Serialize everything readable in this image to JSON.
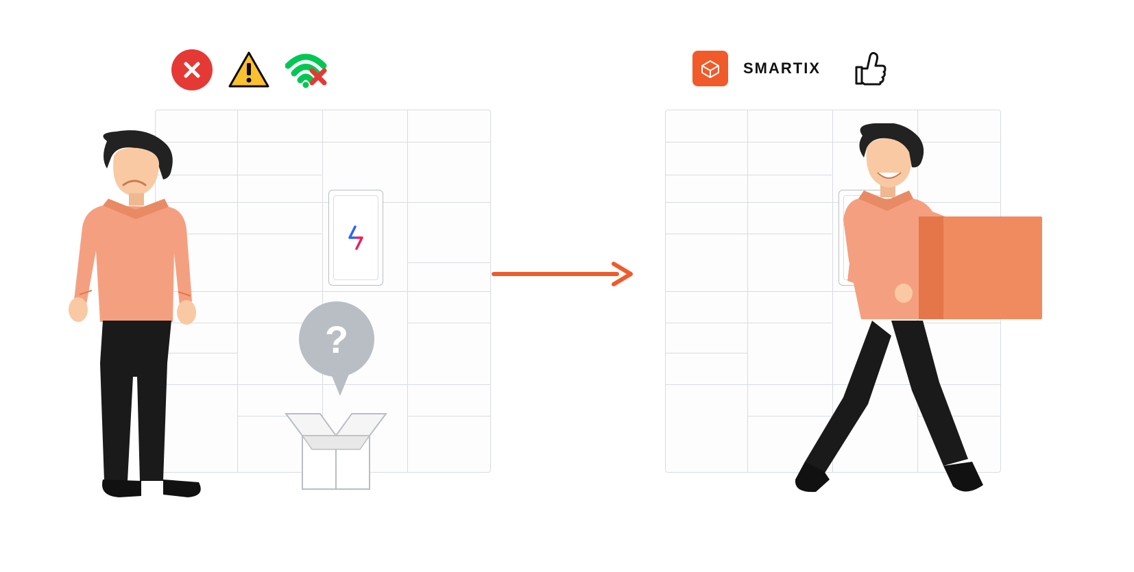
{
  "diagram": {
    "left_scene": {
      "icons": [
        "error",
        "warning",
        "wifi-off"
      ],
      "question_mark": "?",
      "state": "problem"
    },
    "right_scene": {
      "brand": "SMARTIX",
      "icons": [
        "smartix-logo",
        "thumbs-up"
      ],
      "state": "solution"
    },
    "colors": {
      "accent": "#f15a29",
      "error": "#e53935",
      "warning": "#fbc02d",
      "success": "#00c853",
      "locker_border": "#d8dce0",
      "skin": "#f9c9a3",
      "shirt": "#f4a080",
      "pants": "#1a1a1a",
      "hair": "#222222"
    }
  }
}
